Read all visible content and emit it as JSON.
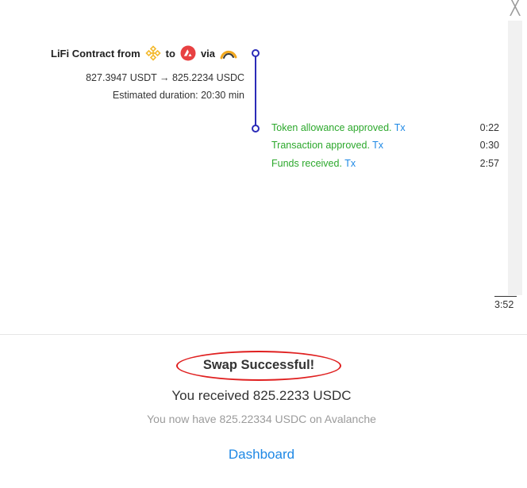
{
  "dialog": {
    "close_icon": "close-icon",
    "close_glyph": "╳"
  },
  "route": {
    "title_prefix": "LiFi Contract from",
    "title_to": "to",
    "title_via": "via",
    "from_chain_icon": "bnb-chain-icon",
    "to_chain_icon": "avalanche-icon",
    "bridge_icon": "bridge-icon",
    "amounts": "827.3947 USDT → 825.2234 USDC",
    "estimated_duration": "Estimated duration: 20:30 min"
  },
  "steps": [
    {
      "label": "Token allowance approved.",
      "link": "Tx",
      "time": "0:22"
    },
    {
      "label": "Transaction approved.",
      "link": "Tx",
      "time": "0:30"
    },
    {
      "label": "Funds received.",
      "link": "Tx",
      "time": "2:57"
    }
  ],
  "total_time": "3:52",
  "result": {
    "title": "Swap Successful!",
    "received": "You received 825.2233 USDC",
    "balance": "You now have 825.22334 USDC on Avalanche",
    "dashboard_link": "Dashboard"
  },
  "colors": {
    "timeline": "#2b2bb8",
    "success_text": "#2ca82c",
    "link": "#1e88e5",
    "highlight_ring": "#e02020",
    "bnb": "#f3ba2f",
    "avalanche": "#e84142"
  }
}
